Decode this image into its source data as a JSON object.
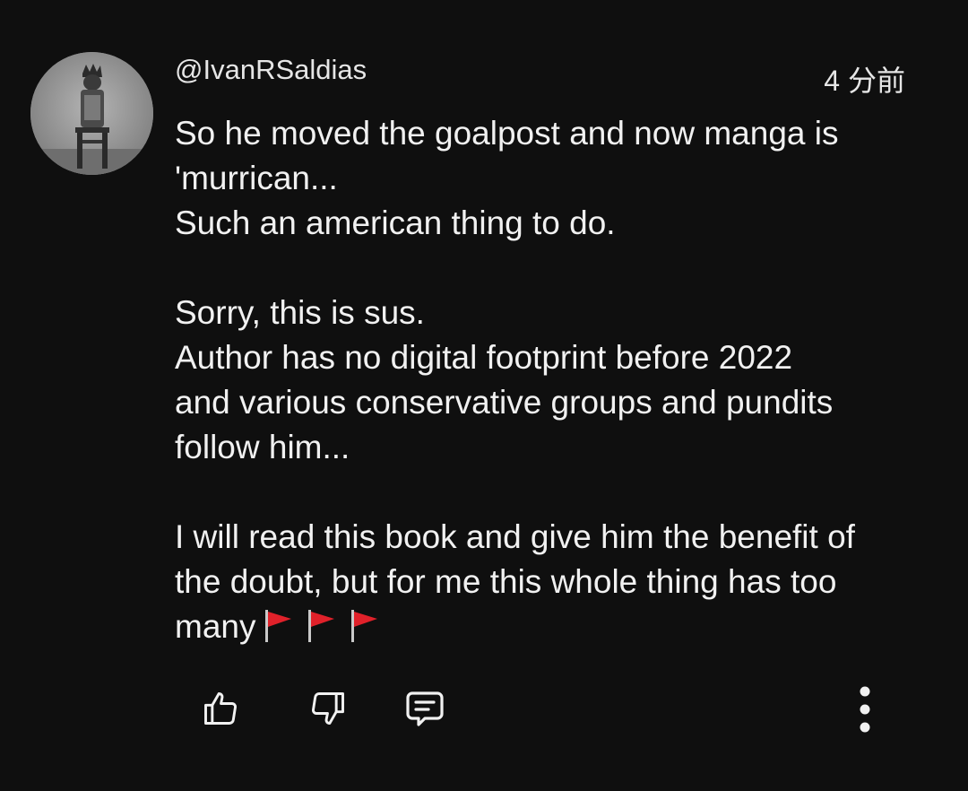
{
  "comment": {
    "author": "@IvanRSaldias",
    "timestamp": "4 分前",
    "lines": [
      "So he moved the goalpost and now manga is",
      "'murrican...",
      "Such an american thing to do.",
      "",
      "Sorry, this is sus.",
      "Author has no digital footprint before 2022",
      "and various conservative groups and pundits",
      "follow him...",
      "",
      "I will read this book and give him the benefit of",
      "the doubt, but for me this whole thing has too",
      "many"
    ],
    "trailing_emoji": [
      "red-flag-icon",
      "red-flag-icon",
      "red-flag-icon"
    ]
  },
  "actions": {
    "like_icon": "thumbs-up-icon",
    "dislike_icon": "thumbs-down-icon",
    "reply_icon": "comment-icon",
    "more_icon": "more-vertical-icon"
  },
  "colors": {
    "background": "#0f0f0f",
    "text": "#f1f1f1",
    "flag_red": "#e0212a"
  }
}
